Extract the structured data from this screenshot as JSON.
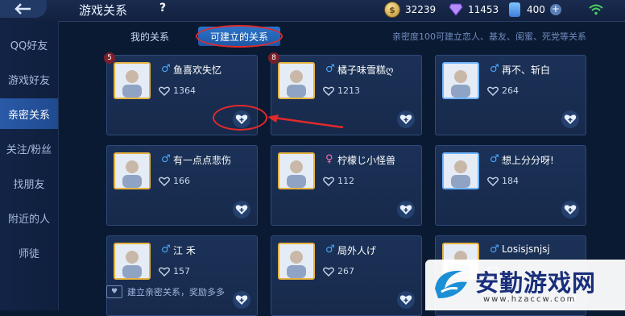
{
  "header": {
    "back_icon": "back-arrow-icon",
    "title": "游戏关系",
    "help": "?",
    "resources": [
      {
        "icon": "gold-coin-icon",
        "value": "32239"
      },
      {
        "icon": "diamond-gem-icon",
        "value": "11453"
      },
      {
        "icon": "coupon-ticket-icon",
        "value": "400"
      }
    ],
    "add": "+",
    "signal_icon": "wifi-icon"
  },
  "sidebar": {
    "items": [
      {
        "label": "QQ好友",
        "active": false
      },
      {
        "label": "游戏好友",
        "active": false
      },
      {
        "label": "亲密关系",
        "active": true
      },
      {
        "label": "关注/粉丝",
        "active": false
      },
      {
        "label": "找朋友",
        "active": false
      },
      {
        "label": "附近的人",
        "active": false
      },
      {
        "label": "师徒",
        "active": false
      }
    ]
  },
  "tabs": [
    {
      "label": "我的关系",
      "active": false
    },
    {
      "label": "可建立的关系",
      "active": true
    }
  ],
  "intro": "亲密度100可建立恋人、基友、闺蜜、死党等关系",
  "friends": [
    {
      "name": "鱼喜欢失忆",
      "gender": "♂",
      "gender_type": "male",
      "intimacy": "1364",
      "level": "5",
      "frame": "gold"
    },
    {
      "name": "橘子味雪糕ღ",
      "gender": "♂",
      "gender_type": "male",
      "intimacy": "1213",
      "level": "8",
      "frame": "gold"
    },
    {
      "name": "再不、斩白",
      "gender": "♂",
      "gender_type": "male",
      "intimacy": "264",
      "level": "",
      "frame": "blue"
    },
    {
      "name": "有一点点悲伤",
      "gender": "♂",
      "gender_type": "male",
      "intimacy": "166",
      "level": "",
      "frame": "gold"
    },
    {
      "name": "柠檬じ小怪兽",
      "gender": "♀",
      "gender_type": "female",
      "intimacy": "112",
      "level": "",
      "frame": "gold"
    },
    {
      "name": "想上分分呀!",
      "gender": "♂",
      "gender_type": "male",
      "intimacy": "184",
      "level": "",
      "frame": "blue"
    },
    {
      "name": "江  禾",
      "gender": "♂",
      "gender_type": "male",
      "intimacy": "157",
      "level": "",
      "frame": "gold"
    },
    {
      "name": "局外人げ",
      "gender": "♂",
      "gender_type": "male",
      "intimacy": "267",
      "level": "",
      "frame": "gold"
    },
    {
      "name": "Losisjsnjsj",
      "gender": "♂",
      "gender_type": "male",
      "intimacy": "",
      "level": "",
      "frame": "gold"
    }
  ],
  "footer": {
    "hint": "建立亲密关系，奖励多多"
  },
  "watermark": {
    "text": "安勤游戏网",
    "url": "www.hzaccw.com"
  },
  "colors": {
    "accent": "#2c74c9",
    "annotation": "#e02a2a",
    "male": "#4aa8ff",
    "female": "#ff6fa8"
  }
}
